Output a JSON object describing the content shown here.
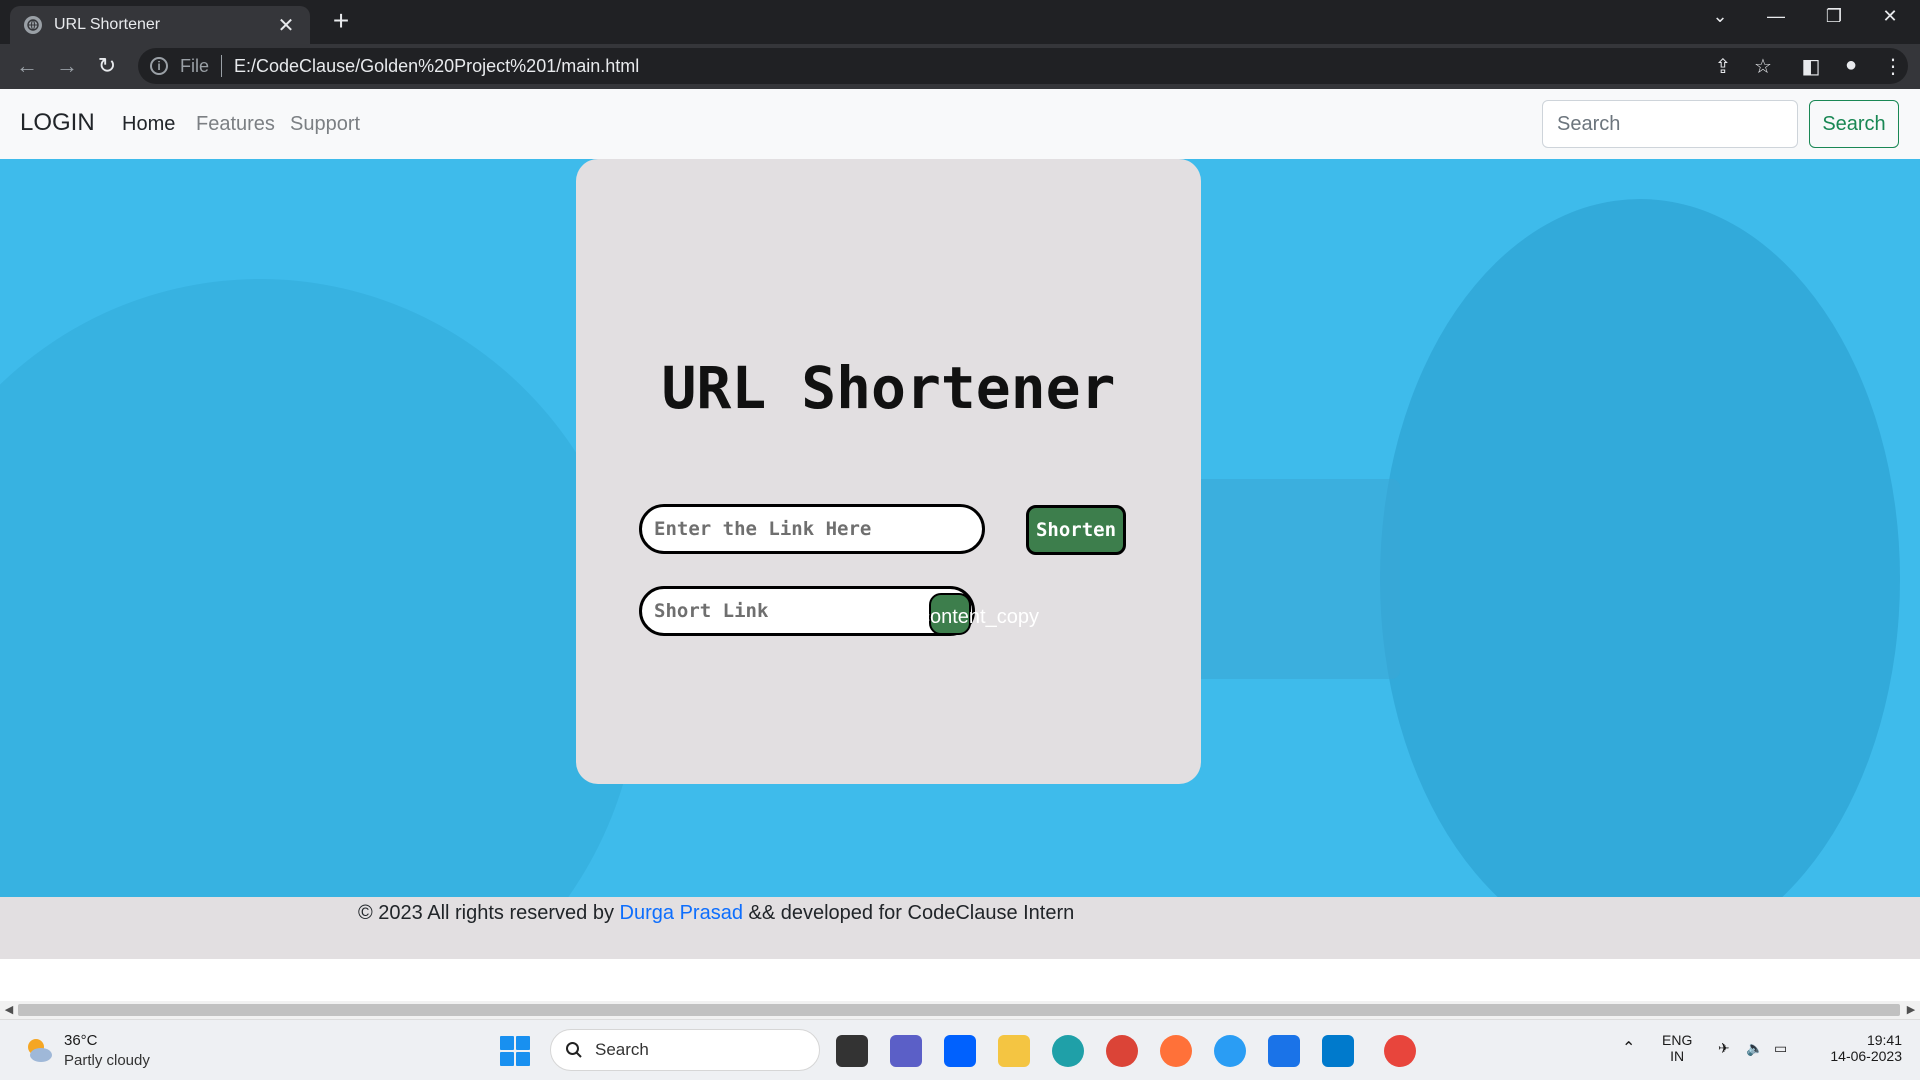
{
  "browser": {
    "tab_title": "URL Shortener",
    "tab_close": "✕",
    "new_tab": "+",
    "url_protocol": "File",
    "url": "E:/CodeClause/Golden%20Project%201/main.html"
  },
  "navbar": {
    "brand": "LOGIN",
    "links": [
      "Home",
      "Features",
      "Support"
    ],
    "search_placeholder": "Search",
    "search_button": "Search"
  },
  "card": {
    "title": "URL Shortener",
    "link_placeholder": "Enter the Link Here",
    "shorten_button": "Shorten",
    "short_placeholder": "Short Link",
    "copy_icon_text": "content_copy"
  },
  "footer": {
    "prefix": "© 2023 All rights reserved by ",
    "author": "Durga Prasad",
    "suffix": " && developed for CodeClause Intern"
  },
  "taskbar": {
    "weather_temp": "36°C",
    "weather_desc": "Partly cloudy",
    "search_label": "Search",
    "lang_line1": "ENG",
    "lang_line2": "IN",
    "time": "19:41",
    "date": "14-06-2023"
  },
  "colors": {
    "hero_bg": "#3ebbeb",
    "card_bg": "#e2dfe1",
    "button_green": "#3d7e4c",
    "link_blue": "#0d6efd"
  }
}
